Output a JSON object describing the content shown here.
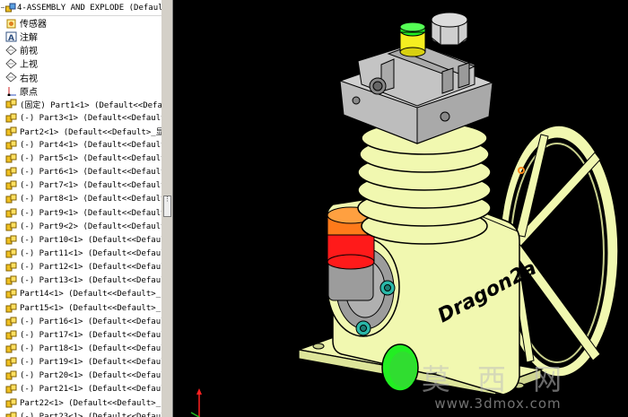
{
  "tree": {
    "header": "4-ASSEMBLY AND EXPLODE (Default<",
    "features": [
      {
        "icon": "sensor-folder-icon",
        "label": "传感器"
      },
      {
        "icon": "annotation-icon",
        "label": "注解"
      },
      {
        "icon": "plane-icon",
        "label": "前视"
      },
      {
        "icon": "plane-icon",
        "label": "上视"
      },
      {
        "icon": "plane-icon",
        "label": "右视"
      },
      {
        "icon": "origin-icon",
        "label": "原点"
      }
    ],
    "parts": [
      "(固定) Part1<1> (Default<<Defa",
      "(-) Part3<1> (Default<<Default",
      "Part2<1> (Default<<Default>_显",
      "(-) Part4<1> (Default<<Default",
      "(-) Part5<1> (Default<<Default",
      "(-) Part6<1> (Default<<Default",
      "(-) Part7<1> (Default<<Default",
      "(-) Part8<1> (Default<<Default",
      "(-) Part9<1> (Default<<Default",
      "(-) Part9<2> (Default<<Default",
      "(-) Part10<1> (Default<<Defaul",
      "(-) Part11<1> (Default<<Defaul",
      "(-) Part12<1> (Default<<Defaul",
      "(-) Part13<1> (Default<<Defaul",
      "Part14<1> (Default<<Default>_F",
      "Part15<1> (Default<<Default>_F",
      "(-) Part16<1> (Default<<Defaul",
      "(-) Part17<1> (Default<<Defaul",
      "(-) Part18<1> (Default<<Defaul",
      "(-) Part19<1> (Default<<Defaul",
      "(-) Part20<1> (Default<<Defaul",
      "(-) Part21<1> (Default<<Defaul",
      "Part22<1> (Default<<Default>_E",
      "(-) Part23<1> (Default<<Defaul"
    ]
  },
  "viewport": {
    "model_engraving": "Dragon2a",
    "watermark": "莫 西 网",
    "watermark_url": "www.3dmox.com"
  },
  "colors": {
    "body": "#f1f8b0",
    "head": "#c9c9c9",
    "cap_orange": "#ff7a1a",
    "cap_red": "#ff1a1a",
    "green_button": "#22ee22",
    "cap_yellow": "#f5ee20",
    "bolt_teal": "#2ab7a8"
  }
}
